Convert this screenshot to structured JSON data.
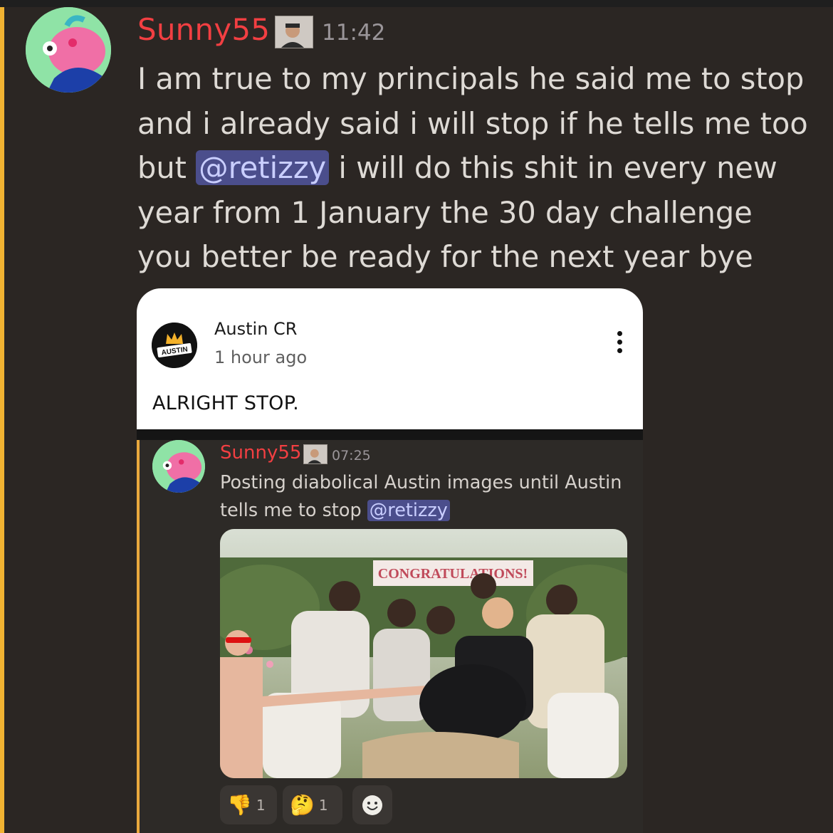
{
  "main_message": {
    "username": "Sunny55",
    "timestamp": "11:42",
    "text_part1": "I am true to my principals he said me to stop and i already said i will stop if he tells me too but ",
    "mention": "@retizzy",
    "text_part2": "  i will do this shit in every new year from 1 January the 30 day challenge you better be ready for the next year bye"
  },
  "youtube_comment": {
    "channel_name": "Austin CR",
    "time_ago": "1 hour ago",
    "text": "ALRIGHT STOP.",
    "avatar_label": "AUSTIN"
  },
  "quoted_message": {
    "username": "Sunny55",
    "timestamp": "07:25",
    "text": "Posting diabolical Austin images until Austin tells me to stop ",
    "mention": "@retizzy",
    "banner_text": "CONGRATULATIONS!"
  },
  "reactions": [
    {
      "emoji": "👎",
      "count": "1"
    },
    {
      "emoji": "🤔",
      "count": "1"
    }
  ],
  "colors": {
    "username": "#f23f42",
    "highlight_bar": "#f0b232",
    "mention_bg": "#4b4e8c",
    "background": "#2b2623"
  }
}
